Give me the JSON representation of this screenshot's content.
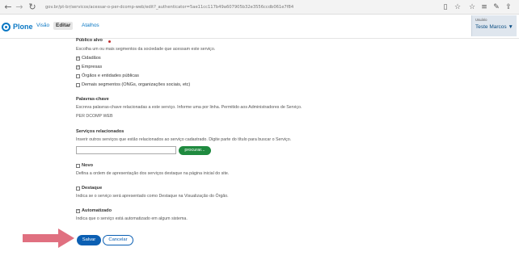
{
  "browser": {
    "url": "gov.br/pt-br/servicos/acessar-o-per-dcomp-web/edit?_authenticator=5ae11cc117b49a607905b32e3556ccdb061e7f84"
  },
  "toolbar": {
    "logo": "Plone",
    "tabs": [
      "Visão",
      "Editar",
      "Atalhos"
    ],
    "active_tab": "Editar",
    "user_label": "Usuário",
    "user_name": "Teste Marcos ▼"
  },
  "form": {
    "publico": {
      "label": "Público alvo",
      "help": "Escolha um ou mais segmentos da sociedade que acessam este serviço.",
      "options": [
        {
          "label": "Cidadãos",
          "checked": true
        },
        {
          "label": "Empresas",
          "checked": true
        },
        {
          "label": "Órgãos e entidades públicas",
          "checked": false
        },
        {
          "label": "Demais segmentos (ONGs, organizações sociais, etc)",
          "checked": false
        }
      ]
    },
    "palavras": {
      "label": "Palavras-chave",
      "help": "Escreva palavras-chave relacionadas a este serviço. Informe uma por linha. Permitido aos Administradores de Serviço.",
      "value": "PER DCOMP WEB"
    },
    "relacionados": {
      "label": "Serviços relacionados",
      "help": "Inserir outros serviços que estão relacionados ao serviço cadastrado. Digite parte do título para buscar o Serviço.",
      "search_button": "procurar..."
    },
    "novo": {
      "label": "Novo",
      "checked": false,
      "help": "Defina a ordem de apresentação dos serviços destaque na página inicial do site."
    },
    "destaque": {
      "label": "Destaque",
      "checked": false,
      "help": "Indica se o serviço será apresentado como Destaque na Visualização do Órgão."
    },
    "automatizado": {
      "label": "Automatizado",
      "checked": true,
      "help": "Indica que o serviço está automatizado em algum sistema."
    },
    "buttons": {
      "save": "Salvar",
      "cancel": "Cancelar"
    }
  },
  "colors": {
    "brand": "#0b78c4",
    "save": "#0b5fb3",
    "search": "#1f8a3f",
    "arrow": "#e07080"
  }
}
